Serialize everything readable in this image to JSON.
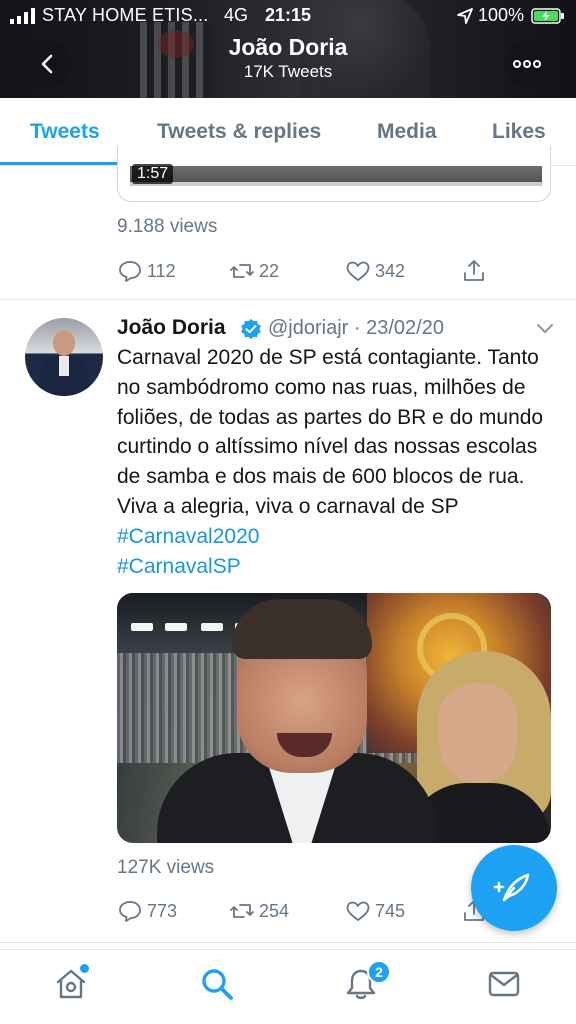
{
  "status_bar": {
    "carrier": "STAY HOME ETIS...",
    "network": "4G",
    "time": "21:15",
    "battery": "100%"
  },
  "header": {
    "name": "João Doria",
    "tweet_count": "17K Tweets",
    "back_icon": "chevron-left-icon",
    "more_icon": "more-dots-icon"
  },
  "tabs": [
    {
      "label": "Tweets",
      "active": true
    },
    {
      "label": "Tweets & replies",
      "active": false
    },
    {
      "label": "Media",
      "active": false
    },
    {
      "label": "Likes",
      "active": false
    }
  ],
  "prev_tweet": {
    "video_duration": "1:57",
    "views": "9.188 views",
    "replies": "112",
    "retweets": "22",
    "likes": "342"
  },
  "tweet": {
    "name": "João Doria",
    "handle": "@jdoriajr · 23/02/20",
    "text": "Carnaval 2020 de SP está contagiante. Tanto no sambódromo como nas ruas, milhões de foliões, de todas as partes do BR e do mundo curtindo o altíssimo nível das nossas escolas de samba e dos mais de 600 blocos de rua. Viva a alegria, viva o carnaval de SP",
    "hashtags": [
      "#Carnaval2020",
      "#CarnavalSP"
    ],
    "views": "127K views",
    "replies": "773",
    "retweets": "254",
    "likes": "745"
  },
  "bottom_nav": {
    "notifications_badge": "2"
  },
  "colors": {
    "accent": "#1da1f2",
    "secondary_text": "#657786",
    "primary_text": "#14171a"
  }
}
